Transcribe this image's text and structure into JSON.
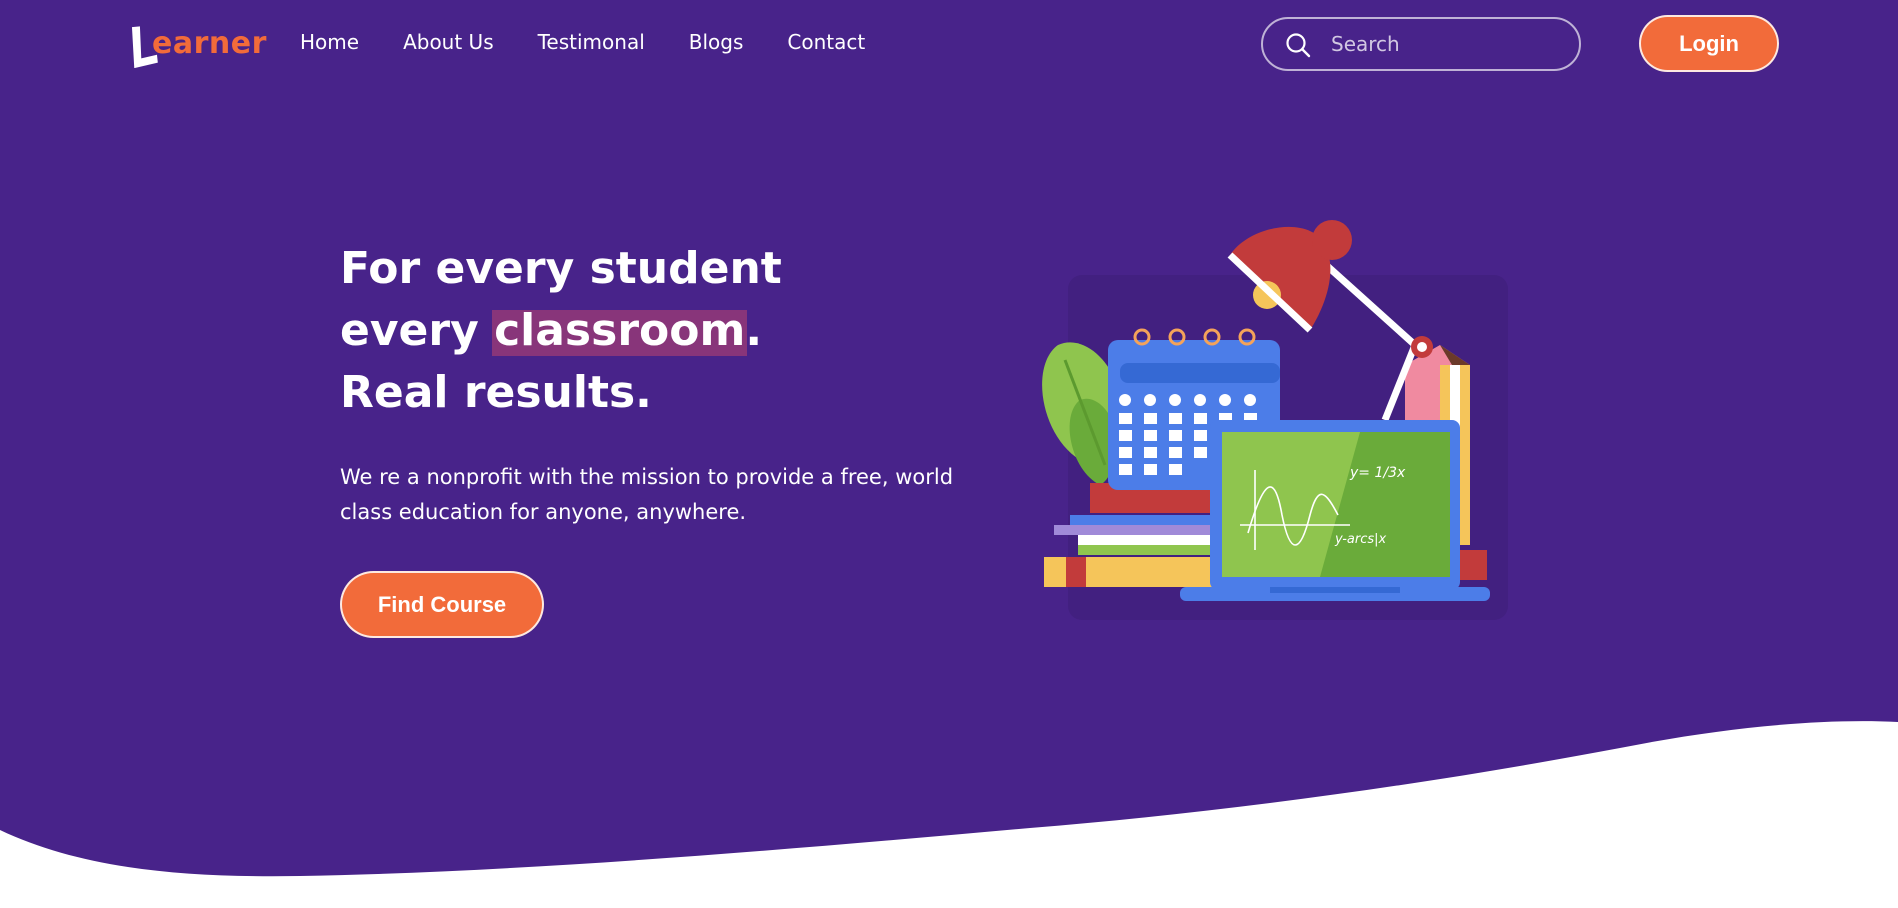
{
  "brand": {
    "logo_text": "earner",
    "logo_letter": "L",
    "primary_color": "#48238a",
    "accent_color": "#f26b3a"
  },
  "nav": {
    "items": [
      {
        "label": "Home"
      },
      {
        "label": "About Us"
      },
      {
        "label": "Testimonal"
      },
      {
        "label": "Blogs"
      },
      {
        "label": "Contact"
      }
    ],
    "search": {
      "placeholder": "Search",
      "icon": "search-icon"
    },
    "login_label": "Login"
  },
  "hero": {
    "line1": "For every student",
    "line2_prefix": "every ",
    "line2_highlight": "classroom",
    "line2_suffix": ".",
    "line3": "Real results.",
    "description": "We re a nonprofit with the mission to provide a free, world class education for anyone, anywhere.",
    "cta_label": "Find Course",
    "illustration": {
      "icon": "education-illustration",
      "board_formula_1": "y= 1/3x",
      "board_formula_2": "y-arcs|x"
    }
  }
}
